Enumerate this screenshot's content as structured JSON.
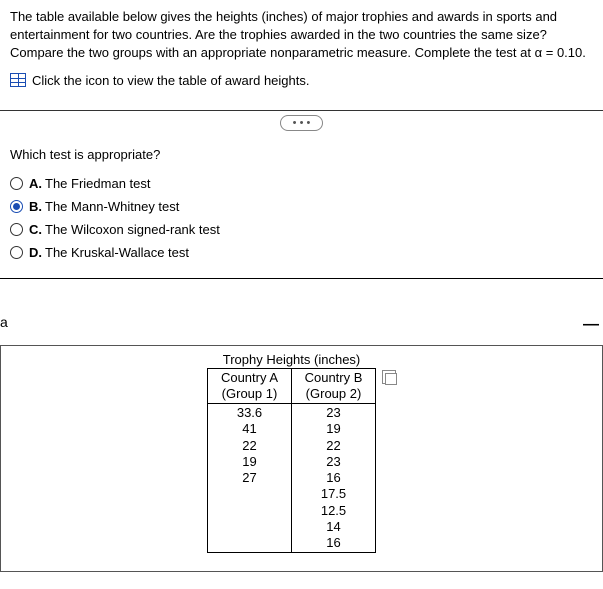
{
  "intro": "The table available below gives the heights (inches) of major trophies and awards in sports and entertainment for two countries. Are the trophies awarded in the two countries the same size? Compare the two groups with an appropriate nonparametric measure. Complete the test at α = 0.10.",
  "link_text": "Click the icon to view the table of award heights.",
  "ellipsis": "• • •",
  "question": "Which test is appropriate?",
  "options": [
    {
      "letter": "A.",
      "text": "The Friedman test",
      "selected": false
    },
    {
      "letter": "B.",
      "text": "The Mann-Whitney test",
      "selected": true
    },
    {
      "letter": "C.",
      "text": "The Wilcoxon signed-rank test",
      "selected": false
    },
    {
      "letter": "D.",
      "text": "The Kruskal-Wallace test",
      "selected": false
    }
  ],
  "side_label": "a",
  "table": {
    "caption": "Trophy Heights (inches)",
    "headers": {
      "col1_line1": "Country A",
      "col1_line2": "(Group 1)",
      "col2_line1": "Country B",
      "col2_line2": "(Group 2)"
    },
    "col1": [
      "33.6",
      "41",
      "22",
      "19",
      "27",
      "",
      "",
      "",
      ""
    ],
    "col2": [
      "23",
      "19",
      "22",
      "23",
      "16",
      "17.5",
      "12.5",
      "14",
      "16"
    ]
  }
}
